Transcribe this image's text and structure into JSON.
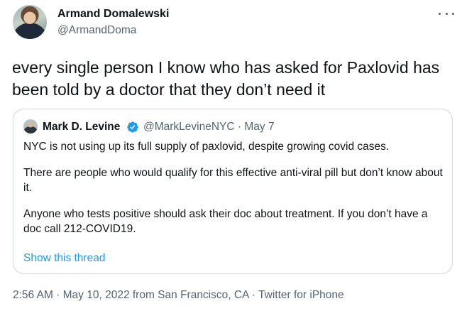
{
  "author": {
    "name": "Armand Domalewski",
    "handle": "@ArmandDoma"
  },
  "tweet": {
    "text": "every single person I know who has asked for Paxlovid has been told by a doctor that they don’t need it"
  },
  "quote": {
    "name": "Mark D. Levine",
    "handle_date": "@MarkLevineNYC · May 7",
    "paragraphs": [
      "NYC is not using up its full supply of paxlovid, despite growing covid cases.",
      "There are people who would qualify for this effective anti-viral pill but don’t know about it.",
      "Anyone who tests positive should ask their doc about treatment. If you don’t have a doc call 212-COVID19."
    ],
    "show_thread": "Show this thread",
    "verified_color": "#1d9bf0"
  },
  "meta": {
    "text": "2:56 AM · May 10, 2022 from San Francisco, CA · Twitter for iPhone"
  },
  "icons": {
    "more": "more-options-icon",
    "verified": "verified-badge-icon"
  }
}
